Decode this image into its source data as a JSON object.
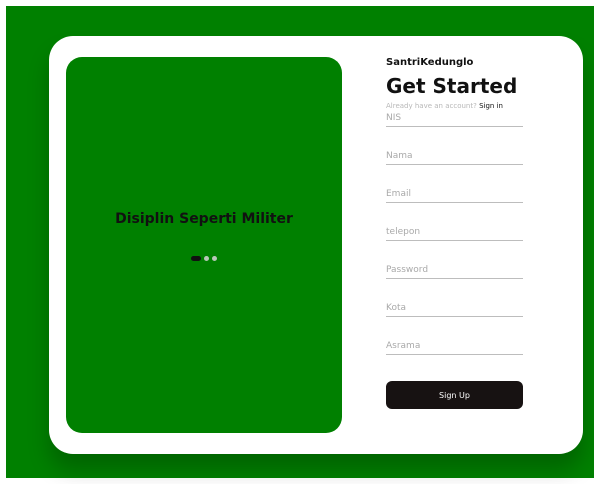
{
  "colors": {
    "page_background": "#008000",
    "card_background": "#ffffff",
    "hero_background": "#008000",
    "button_background": "#171212"
  },
  "hero": {
    "tagline": "Disiplin Seperti Militer",
    "carousel": {
      "slide_count": 3,
      "active_index": 0
    }
  },
  "form": {
    "brand": "SantriKedunglo",
    "title": "Get Started",
    "signin_prompt": "Already have an account?",
    "signin_link": "Sign in",
    "fields": {
      "nis": "NIS",
      "nama": "Nama",
      "email": "Email",
      "telepon": "telepon",
      "password": "Password",
      "kota": "Kota",
      "asrama": "Asrama"
    },
    "submit_label": "Sign Up"
  }
}
